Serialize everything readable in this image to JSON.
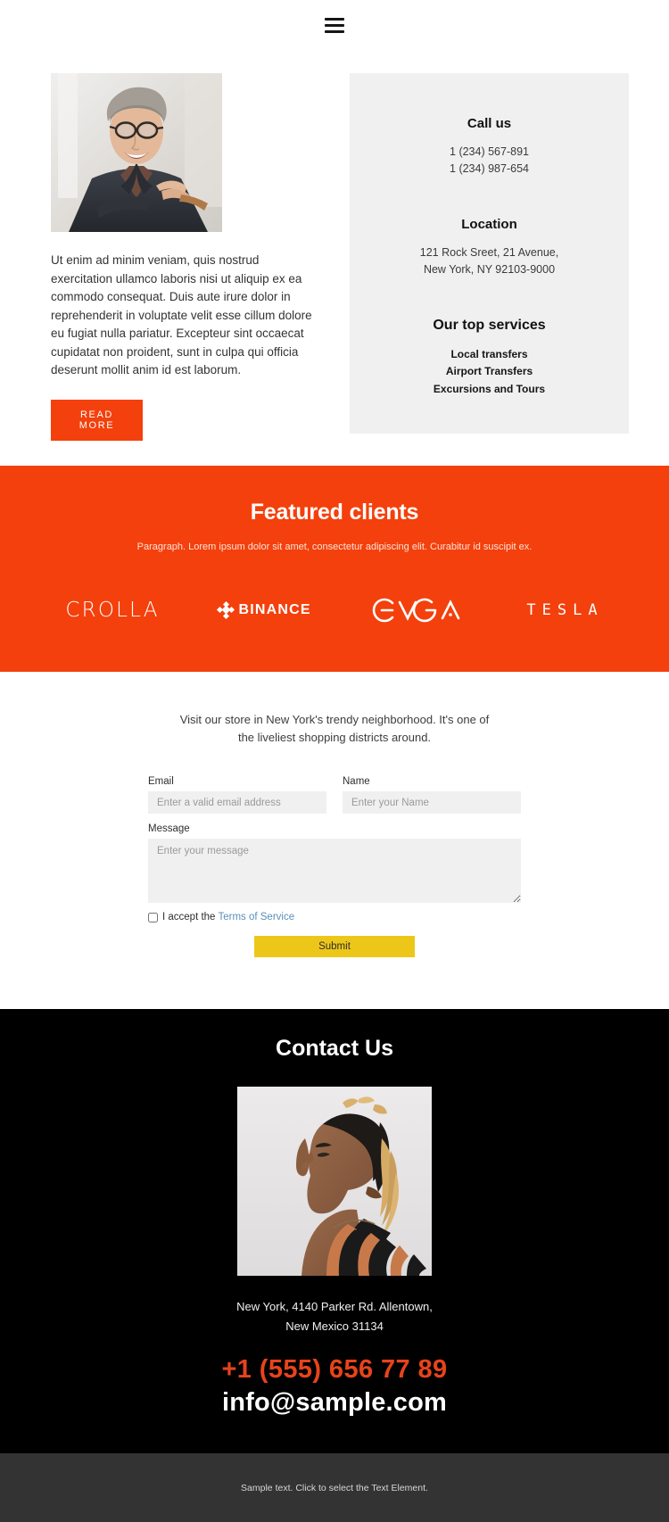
{
  "header": {
    "menu_icon": "hamburger-menu-icon"
  },
  "intro": {
    "photo_alt": "smiling man in dark suit with glasses",
    "body": "Ut enim ad minim veniam, quis nostrud exercitation ullamco laboris nisi ut aliquip ex ea commodo consequat. Duis aute irure dolor in reprehenderit in voluptate velit esse cillum dolore eu fugiat nulla pariatur. Excepteur sint occaecat cupidatat non proident, sunt in culpa qui officia deserunt mollit anim id est laborum.",
    "read_more_label": "READ MORE"
  },
  "info_panel": {
    "call_title": "Call us",
    "phone_1": "1 (234) 567-891",
    "phone_2": "1 (234) 987-654",
    "location_title": "Location",
    "address_line_1": "121 Rock Sreet, 21 Avenue,",
    "address_line_2": "New York, NY 92103-9000",
    "services_title": "Our top services",
    "services": [
      "Local transfers",
      "Airport Transfers",
      "Excursions and Tours"
    ]
  },
  "clients": {
    "title": "Featured clients",
    "subtitle": "Paragraph. Lorem ipsum dolor sit amet, consectetur adipiscing elit. Curabitur id suscipit ex.",
    "logos": [
      "CROLLA",
      "BINANCE",
      "EVGA",
      "TESLA"
    ],
    "bg_color": "#F4400C"
  },
  "form": {
    "intro_line_1": "Visit our store in New York's trendy neighborhood. It's one of",
    "intro_line_2": "the liveliest shopping districts around.",
    "email_label": "Email",
    "email_placeholder": "Enter a valid email address",
    "email_value": "",
    "name_label": "Name",
    "name_placeholder": "Enter your Name",
    "name_value": "",
    "message_label": "Message",
    "message_placeholder": "Enter your message",
    "message_value": "",
    "accept_text": "I accept the",
    "terms_link": "Terms of Service",
    "accept_checked": false,
    "submit_label": "Submit",
    "submit_color": "#ECC71A"
  },
  "dark_contact": {
    "title": "Contact Us",
    "photo_alt": "profile portrait of person with blonde-tipped dreadlocks in striped shirt",
    "address_line_1": "New York, 4140 Parker Rd. Allentown,",
    "address_line_2": "New Mexico 31134",
    "phone": "+1 (555) 656 77 89",
    "email": "info@sample.com",
    "phone_color": "#E8431B"
  },
  "footer": {
    "text": "Sample text. Click to select the Text Element."
  }
}
